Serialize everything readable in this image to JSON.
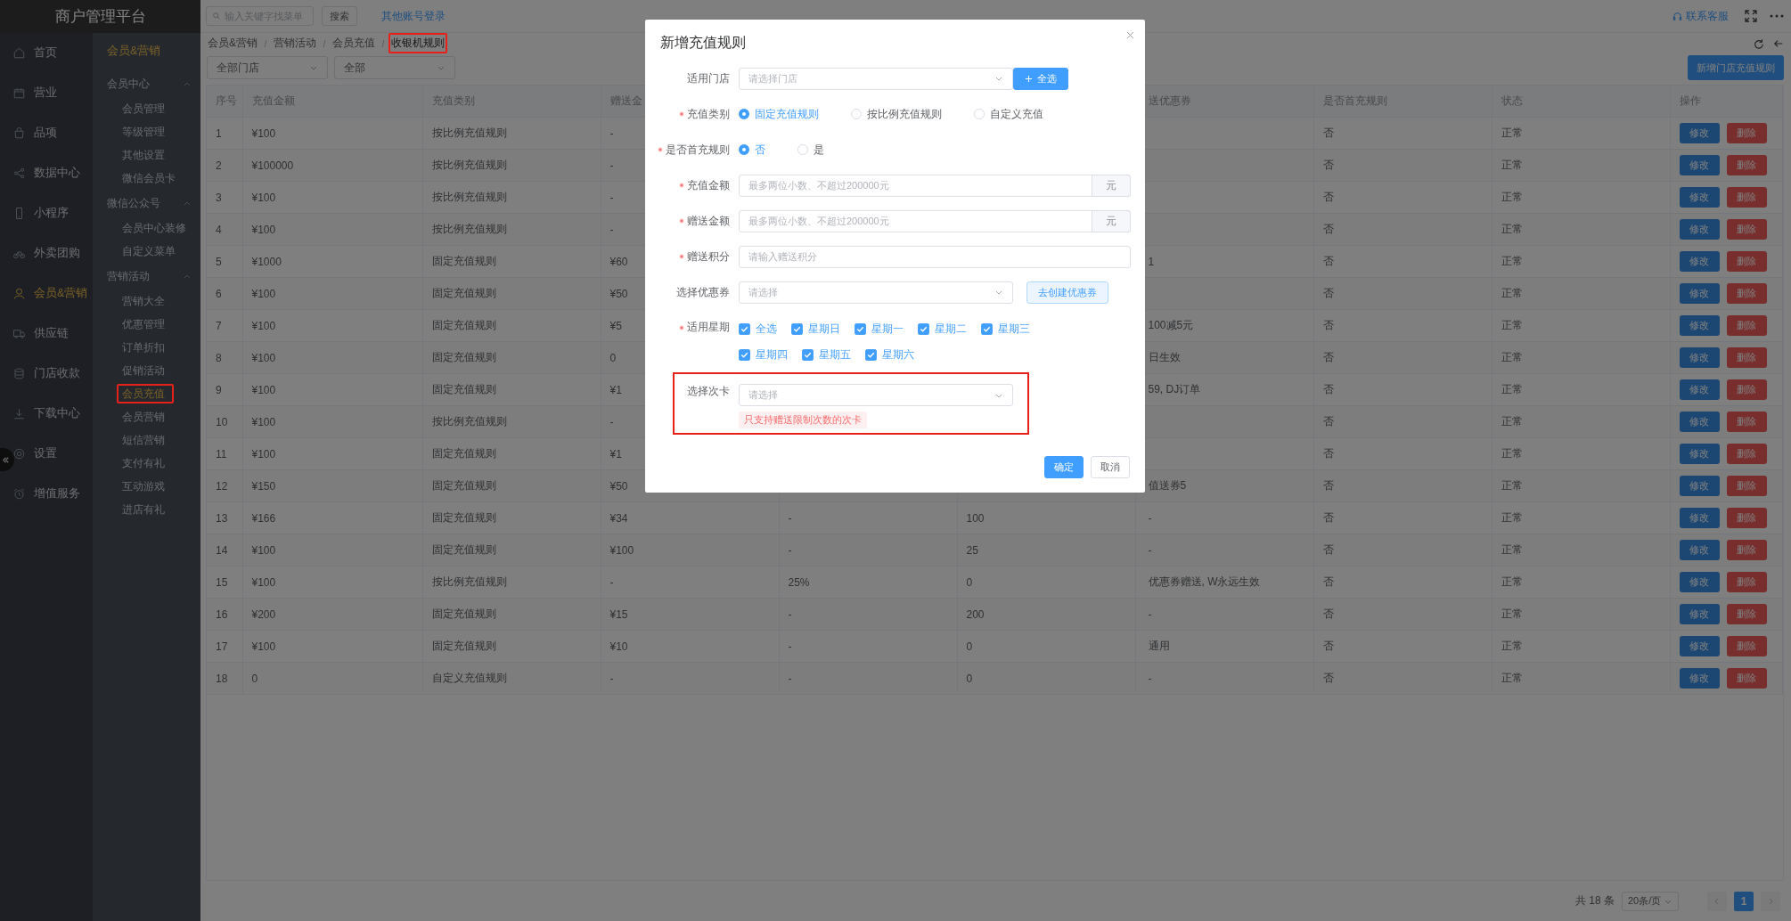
{
  "app_title": "商户管理平台",
  "nav": [
    {
      "label": "首页",
      "selected": false
    },
    {
      "label": "营业",
      "selected": false
    },
    {
      "label": "品项",
      "selected": false
    },
    {
      "label": "数据中心",
      "selected": false
    },
    {
      "label": "小程序",
      "selected": false
    },
    {
      "label": "外卖团购",
      "selected": false
    },
    {
      "label": "会员&营销",
      "selected": true
    },
    {
      "label": "供应链",
      "selected": false
    },
    {
      "label": "门店收款",
      "selected": false
    },
    {
      "label": "下载中心",
      "selected": false
    },
    {
      "label": "设置",
      "selected": false
    },
    {
      "label": "增值服务",
      "selected": false
    }
  ],
  "subnav": {
    "title": "会员&营销",
    "groups": [
      {
        "label": "会员中心",
        "expanded": true,
        "children": [
          {
            "label": "会员管理",
            "selected": false,
            "highlighted": false
          },
          {
            "label": "等级管理",
            "selected": false,
            "highlighted": false
          },
          {
            "label": "其他设置",
            "selected": false,
            "highlighted": false
          },
          {
            "label": "微信会员卡",
            "selected": false,
            "highlighted": false
          }
        ]
      },
      {
        "label": "微信公众号",
        "expanded": true,
        "children": [
          {
            "label": "会员中心装修",
            "selected": false,
            "highlighted": false
          },
          {
            "label": "自定义菜单",
            "selected": false,
            "highlighted": false
          }
        ]
      },
      {
        "label": "营销活动",
        "expanded": true,
        "children": [
          {
            "label": "营销大全",
            "selected": false,
            "highlighted": false
          },
          {
            "label": "优惠管理",
            "selected": false,
            "highlighted": false
          },
          {
            "label": "订单折扣",
            "selected": false,
            "highlighted": false
          },
          {
            "label": "促销活动",
            "selected": false,
            "highlighted": false
          },
          {
            "label": "会员充值",
            "selected": true,
            "highlighted": true
          },
          {
            "label": "会员营销",
            "selected": false,
            "highlighted": false
          },
          {
            "label": "短信营销",
            "selected": false,
            "highlighted": false
          },
          {
            "label": "支付有礼",
            "selected": false,
            "highlighted": false
          },
          {
            "label": "互动游戏",
            "selected": false,
            "highlighted": false
          },
          {
            "label": "进店有礼",
            "selected": false,
            "highlighted": false
          }
        ]
      }
    ]
  },
  "topbar": {
    "search": {
      "placeholder": "输入关键字找菜单"
    },
    "search_button": "搜索",
    "switch_account": "其他账号登录",
    "support": "联系客服"
  },
  "breadcrumb": [
    {
      "label": "会员&营销",
      "highlighted": false
    },
    {
      "label": "营销活动",
      "highlighted": false
    },
    {
      "label": "会员充值",
      "highlighted": false
    },
    {
      "label": "收银机规则",
      "highlighted": true
    }
  ],
  "filters": [
    {
      "value": "全部门店"
    },
    {
      "value": "全部"
    }
  ],
  "add_button": "新增门店充值规则",
  "table": {
    "columns": [
      "序号",
      "充值金额",
      "充值类别",
      "赠送金",
      null,
      null,
      "送优惠券",
      "是否首充规则",
      "状态",
      "操作"
    ],
    "rows": [
      {
        "cells": [
          "1",
          "¥100",
          "按比例充值规则",
          "-",
          null,
          null,
          null,
          "否",
          "正常"
        ],
        "actions": [
          {
            "label": "修改",
            "kind": "edit"
          },
          {
            "label": "删除",
            "kind": "delete"
          }
        ]
      },
      {
        "cells": [
          "2",
          "¥100000",
          "按比例充值规则",
          "-",
          null,
          null,
          null,
          "否",
          "正常"
        ],
        "actions": [
          {
            "label": "修改",
            "kind": "edit"
          },
          {
            "label": "删除",
            "kind": "delete"
          }
        ]
      },
      {
        "cells": [
          "3",
          "¥100",
          "按比例充值规则",
          "-",
          null,
          null,
          null,
          "否",
          "正常"
        ],
        "actions": [
          {
            "label": "修改",
            "kind": "edit"
          },
          {
            "label": "删除",
            "kind": "delete"
          }
        ]
      },
      {
        "cells": [
          "4",
          "¥100",
          "按比例充值规则",
          "-",
          null,
          null,
          null,
          "否",
          "正常"
        ],
        "actions": [
          {
            "label": "修改",
            "kind": "edit"
          },
          {
            "label": "删除",
            "kind": "delete"
          }
        ]
      },
      {
        "cells": [
          "5",
          "¥1000",
          "固定充值规则",
          "¥60",
          null,
          null,
          "1",
          "否",
          "正常"
        ],
        "actions": [
          {
            "label": "修改",
            "kind": "edit"
          },
          {
            "label": "删除",
            "kind": "delete"
          }
        ]
      },
      {
        "cells": [
          "6",
          "¥100",
          "固定充值规则",
          "¥50",
          null,
          null,
          null,
          "否",
          "正常"
        ],
        "actions": [
          {
            "label": "修改",
            "kind": "edit"
          },
          {
            "label": "删除",
            "kind": "delete"
          }
        ]
      },
      {
        "cells": [
          "7",
          "¥100",
          "固定充值规则",
          "¥5",
          null,
          null,
          "100减5元",
          "否",
          "正常"
        ],
        "actions": [
          {
            "label": "修改",
            "kind": "edit"
          },
          {
            "label": "删除",
            "kind": "delete"
          }
        ]
      },
      {
        "cells": [
          "8",
          "¥100",
          "固定充值规则",
          "0",
          null,
          null,
          "日生效",
          "否",
          "正常"
        ],
        "actions": [
          {
            "label": "修改",
            "kind": "edit"
          },
          {
            "label": "删除",
            "kind": "delete"
          }
        ]
      },
      {
        "cells": [
          "9",
          "¥100",
          "固定充值规则",
          "¥1",
          null,
          null,
          "59, DJ订单",
          "否",
          "正常"
        ],
        "actions": [
          {
            "label": "修改",
            "kind": "edit"
          },
          {
            "label": "删除",
            "kind": "delete"
          }
        ]
      },
      {
        "cells": [
          "10",
          "¥100",
          "按比例充值规则",
          "-",
          null,
          null,
          null,
          "否",
          "正常"
        ],
        "actions": [
          {
            "label": "修改",
            "kind": "edit"
          },
          {
            "label": "删除",
            "kind": "delete"
          }
        ]
      },
      {
        "cells": [
          "11",
          "¥100",
          "固定充值规则",
          "¥1",
          null,
          null,
          null,
          "否",
          "正常"
        ],
        "actions": [
          {
            "label": "修改",
            "kind": "edit"
          },
          {
            "label": "删除",
            "kind": "delete"
          }
        ]
      },
      {
        "cells": [
          "12",
          "¥150",
          "固定充值规则",
          "¥50",
          null,
          null,
          "值送券5",
          "否",
          "正常"
        ],
        "actions": [
          {
            "label": "修改",
            "kind": "edit"
          },
          {
            "label": "删除",
            "kind": "delete"
          }
        ]
      },
      {
        "cells": [
          "13",
          "¥166",
          "固定充值规则",
          "¥34",
          "-",
          "100",
          "-",
          "否",
          "正常"
        ],
        "actions": [
          {
            "label": "修改",
            "kind": "edit"
          },
          {
            "label": "删除",
            "kind": "delete"
          }
        ]
      },
      {
        "cells": [
          "14",
          "¥100",
          "固定充值规则",
          "¥100",
          "-",
          "25",
          "-",
          "否",
          "正常"
        ],
        "actions": [
          {
            "label": "修改",
            "kind": "edit"
          },
          {
            "label": "删除",
            "kind": "delete"
          }
        ]
      },
      {
        "cells": [
          "15",
          "¥100",
          "按比例充值规则",
          "-",
          "25%",
          "0",
          "优惠券赠送, W永远生效",
          "否",
          "正常"
        ],
        "actions": [
          {
            "label": "修改",
            "kind": "edit"
          },
          {
            "label": "删除",
            "kind": "delete"
          }
        ]
      },
      {
        "cells": [
          "16",
          "¥200",
          "固定充值规则",
          "¥15",
          "-",
          "200",
          "-",
          "否",
          "正常"
        ],
        "actions": [
          {
            "label": "修改",
            "kind": "edit"
          },
          {
            "label": "删除",
            "kind": "delete"
          }
        ]
      },
      {
        "cells": [
          "17",
          "¥100",
          "固定充值规则",
          "¥10",
          "-",
          "0",
          "通用",
          "否",
          "正常"
        ],
        "actions": [
          {
            "label": "修改",
            "kind": "edit"
          },
          {
            "label": "删除",
            "kind": "delete"
          }
        ]
      },
      {
        "cells": [
          "18",
          "0",
          "自定义充值规则",
          "-",
          "-",
          "0",
          "-",
          "否",
          "正常"
        ],
        "actions": [
          {
            "label": "修改",
            "kind": "edit"
          },
          {
            "label": "删除",
            "kind": "delete"
          }
        ]
      }
    ]
  },
  "pagination": {
    "total": "共 18 条",
    "page_size": "20条/页",
    "pages": [
      {
        "label": "1",
        "selected": true
      }
    ]
  },
  "modal": {
    "title": "新增充值规则",
    "fields": [
      {
        "kind": "select",
        "label": "适用门店",
        "required": false,
        "placeholder": "请选择门店",
        "button": {
          "label": "全选",
          "kind": "primary"
        }
      },
      {
        "kind": "radio",
        "label": "充值类别",
        "required": true,
        "options": [
          {
            "label": "固定充值规则",
            "selected": true
          },
          {
            "label": "按比例充值规则",
            "selected": false
          },
          {
            "label": "自定义充值",
            "selected": false
          }
        ]
      },
      {
        "kind": "radio",
        "label": "是否首充规则",
        "required": true,
        "options": [
          {
            "label": "否",
            "selected": true
          },
          {
            "label": "是",
            "selected": false
          }
        ]
      },
      {
        "kind": "input",
        "label": "充值金额",
        "required": true,
        "placeholder": "最多两位小数、不超过200000元",
        "suffix": "元"
      },
      {
        "kind": "input",
        "label": "赠送金额",
        "required": true,
        "placeholder": "最多两位小数、不超过200000元",
        "suffix": "元"
      },
      {
        "kind": "input",
        "label": "赠送积分",
        "required": true,
        "placeholder": "请输入赠送积分"
      },
      {
        "kind": "select",
        "label": "选择优惠券",
        "required": false,
        "placeholder": "请选择",
        "button": {
          "label": "去创建优惠券",
          "kind": "plain"
        }
      },
      {
        "kind": "checkbox",
        "label": "适用星期",
        "required": true,
        "options": [
          {
            "label": "全选",
            "checked": true
          },
          {
            "label": "星期日",
            "checked": true
          },
          {
            "label": "星期一",
            "checked": true
          },
          {
            "label": "星期二",
            "checked": true
          },
          {
            "label": "星期三",
            "checked": true
          },
          {
            "label": "星期四",
            "checked": true
          },
          {
            "label": "星期五",
            "checked": true
          },
          {
            "label": "星期六",
            "checked": true
          }
        ]
      },
      {
        "kind": "select",
        "label": "选择次卡",
        "required": false,
        "placeholder": "请选择",
        "tip": "只支持赠送限制次数的次卡",
        "highlighted": true
      }
    ],
    "buttons": [
      {
        "label": "确定",
        "kind": "primary"
      },
      {
        "label": "取消",
        "kind": "default"
      }
    ]
  }
}
